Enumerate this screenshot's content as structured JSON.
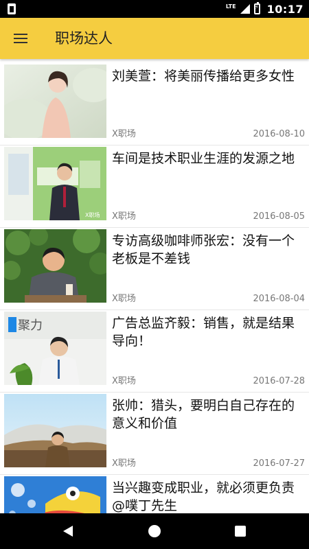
{
  "status_bar": {
    "network": "LTE",
    "time": "10:17"
  },
  "toolbar": {
    "title": "职场达人"
  },
  "articles": [
    {
      "title": "刘美萱：将美丽传播给更多女性",
      "source": "X职场",
      "date": "2016-08-10"
    },
    {
      "title": "车间是技术职业生涯的发源之地",
      "source": "X职场",
      "date": "2016-08-05"
    },
    {
      "title": "专访高级咖啡师张宏：没有一个老板是不差钱",
      "source": "X职场",
      "date": "2016-08-04"
    },
    {
      "title": "广告总监齐毅：销售，就是结果导向！",
      "source": "X职场",
      "date": "2016-07-28"
    },
    {
      "title": "张帅：猎头，要明白自己存在的意义和价值",
      "source": "X职场",
      "date": "2016-07-27"
    },
    {
      "title": "当兴趣变成职业，就必须更负责 @噗丁先生",
      "source": "",
      "date": ""
    }
  ],
  "thumbnail_logos": {
    "logo_1": "X职场",
    "logo_2": "聚力"
  },
  "colors": {
    "toolbar": "#f5cd40",
    "system_bars": "#000000"
  }
}
